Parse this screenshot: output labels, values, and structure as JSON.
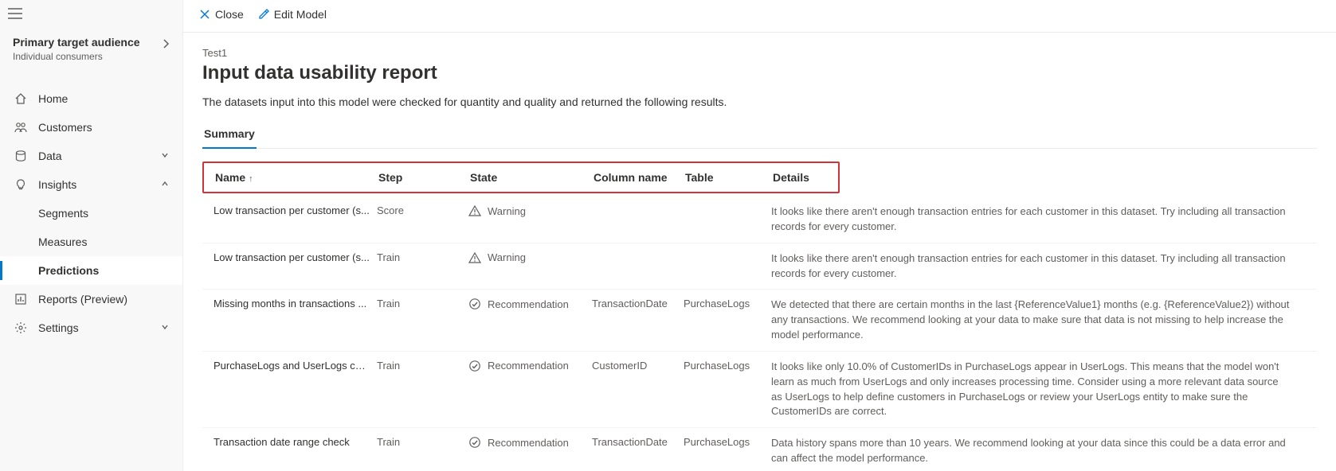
{
  "audience": {
    "title": "Primary target audience",
    "subtitle": "Individual consumers"
  },
  "nav": {
    "home": "Home",
    "customers": "Customers",
    "data": "Data",
    "insights": "Insights",
    "insights_children": {
      "segments": "Segments",
      "measures": "Measures",
      "predictions": "Predictions"
    },
    "reports": "Reports (Preview)",
    "settings": "Settings"
  },
  "toolbar": {
    "close": "Close",
    "edit_model": "Edit Model"
  },
  "page": {
    "breadcrumb": "Test1",
    "title": "Input data usability report",
    "description": "The datasets input into this model were checked for quantity and quality and returned the following results."
  },
  "tabs": {
    "summary": "Summary"
  },
  "table": {
    "headers": {
      "name": "Name",
      "step": "Step",
      "state": "State",
      "column_name": "Column name",
      "table": "Table",
      "details": "Details"
    },
    "rows": [
      {
        "name": "Low transaction per customer (s...",
        "step": "Score",
        "state": "Warning",
        "state_kind": "warning",
        "column": "",
        "table": "",
        "details": "It looks like there aren't enough transaction entries for each customer in this dataset. Try including all transaction records for every customer."
      },
      {
        "name": "Low transaction per customer (s...",
        "step": "Train",
        "state": "Warning",
        "state_kind": "warning",
        "column": "",
        "table": "",
        "details": "It looks like there aren't enough transaction entries for each customer in this dataset. Try including all transaction records for every customer."
      },
      {
        "name": "Missing months in transactions ...",
        "step": "Train",
        "state": "Recommendation",
        "state_kind": "recommendation",
        "column": "TransactionDate",
        "table": "PurchaseLogs",
        "details": "We detected that there are certain months in the last {ReferenceValue1} months (e.g. {ReferenceValue2}) without any transactions. We recommend looking at your data to make sure that data is not missing to help increase the model performance."
      },
      {
        "name": "PurchaseLogs and UserLogs cus...",
        "step": "Train",
        "state": "Recommendation",
        "state_kind": "recommendation",
        "column": "CustomerID",
        "table": "PurchaseLogs",
        "details": "It looks like only 10.0% of CustomerIDs in PurchaseLogs appear in UserLogs. This means that the model won't learn as much from UserLogs and only increases processing time. Consider using a more relevant data source as UserLogs to help define customers in PurchaseLogs or review your UserLogs entity to make sure the CustomerIDs are correct."
      },
      {
        "name": "Transaction date range check",
        "step": "Train",
        "state": "Recommendation",
        "state_kind": "recommendation",
        "column": "TransactionDate",
        "table": "PurchaseLogs",
        "details": "Data history spans more than 10 years. We recommend looking at your data since this could be a data error and can affect the model performance."
      }
    ]
  }
}
